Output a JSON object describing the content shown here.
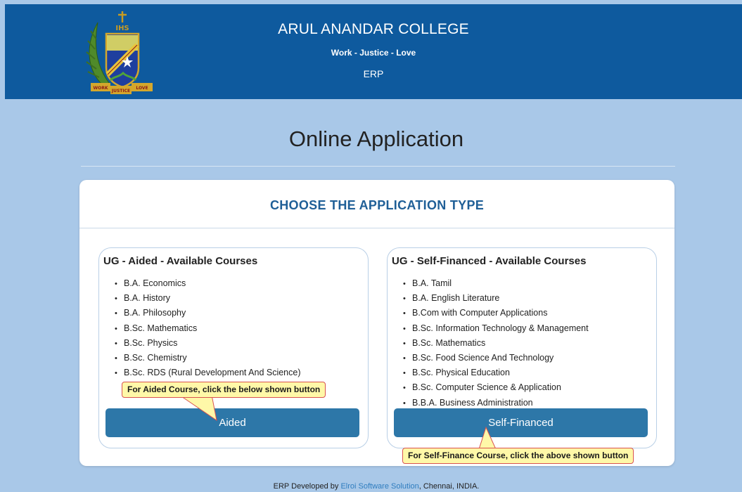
{
  "header": {
    "college_name": "ARUL ANANDAR COLLEGE",
    "motto": "Work - Justice - Love",
    "subtitle": "ERP",
    "logo": {
      "top_text": "IHS",
      "ribbon_left": "WORK",
      "ribbon_center": "JUSTICE",
      "ribbon_right": "LOVE"
    }
  },
  "page_title": "Online Application",
  "card": {
    "title": "CHOOSE THE APPLICATION TYPE",
    "aided": {
      "panel_title": "UG - Aided - Available Courses",
      "courses": [
        "B.A. Economics",
        "B.A. History",
        "B.A. Philosophy",
        "B.Sc. Mathematics",
        "B.Sc. Physics",
        "B.Sc. Chemistry",
        "B.Sc. RDS (Rural Development And Science)"
      ],
      "button_label": "Aided",
      "callout": "For Aided Course, click the below shown button"
    },
    "self_financed": {
      "panel_title": "UG - Self-Financed - Available Courses",
      "courses": [
        "B.A. Tamil",
        "B.A. English Literature",
        "B.Com with Computer Applications",
        "B.Sc. Information Technology & Management",
        "B.Sc. Mathematics",
        "B.Sc. Food Science And Technology",
        "B.Sc. Physical Education",
        "B.Sc. Computer Science & Application",
        "B.B.A. Business Administration"
      ],
      "button_label": "Self-Financed",
      "callout": "For Self-Finance Course, click the above shown button"
    }
  },
  "footer": {
    "prefix": "ERP Developed by ",
    "link_text": "Elroi Software Solution",
    "suffix": ", Chennai, INDIA."
  },
  "colors": {
    "page_background": "#a9c8e8",
    "header_background": "#0e5a9e",
    "button_background": "#2d77a8",
    "card_title": "#1f5f97",
    "callout_background": "#fff8a8",
    "callout_border": "#d9534f",
    "footer_link": "#2f7dbf"
  }
}
